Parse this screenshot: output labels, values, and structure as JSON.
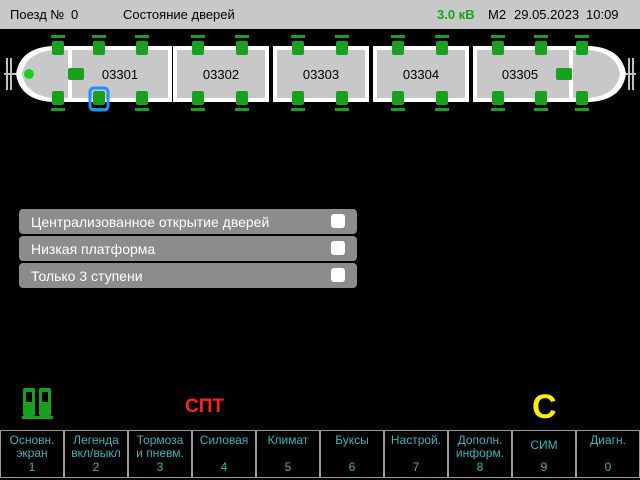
{
  "header": {
    "train_label": "Поезд №",
    "train_no": "0",
    "screen_title": "Состояние дверей",
    "voltage": "3.0 кВ",
    "mode": "М2",
    "date": "29.05.2023",
    "time": "10:09"
  },
  "cars": [
    "03301",
    "03302",
    "03303",
    "03304",
    "03305"
  ],
  "options": [
    {
      "label": "Централизованное открытие дверей",
      "checked": false
    },
    {
      "label": "Низкая платформа",
      "checked": false
    },
    {
      "label": "Только 3 ступени",
      "checked": false
    }
  ],
  "indicators": {
    "spt": "СПТ",
    "c": "С",
    "colors": {
      "door_green": "#19a01e",
      "selected_blue": "#1e90ff",
      "spt_red": "#ff2020",
      "c_yellow": "#ffee00",
      "voltage_green": "#17a31a"
    }
  },
  "nav": [
    {
      "label": "Основн.\nэкран",
      "num": "1"
    },
    {
      "label": "Легенда\nвкл/выкл",
      "num": "2"
    },
    {
      "label": "Тормоза\nи пневм.",
      "num": "3"
    },
    {
      "label": "Силовая",
      "num": "4"
    },
    {
      "label": "Климат",
      "num": "5"
    },
    {
      "label": "Буксы",
      "num": "6"
    },
    {
      "label": "Настрой.",
      "num": "7"
    },
    {
      "label": "Дополн.\nинформ.",
      "num": "8"
    },
    {
      "label": "СИМ",
      "num": "9"
    },
    {
      "label": "Диагн.",
      "num": "0"
    }
  ]
}
